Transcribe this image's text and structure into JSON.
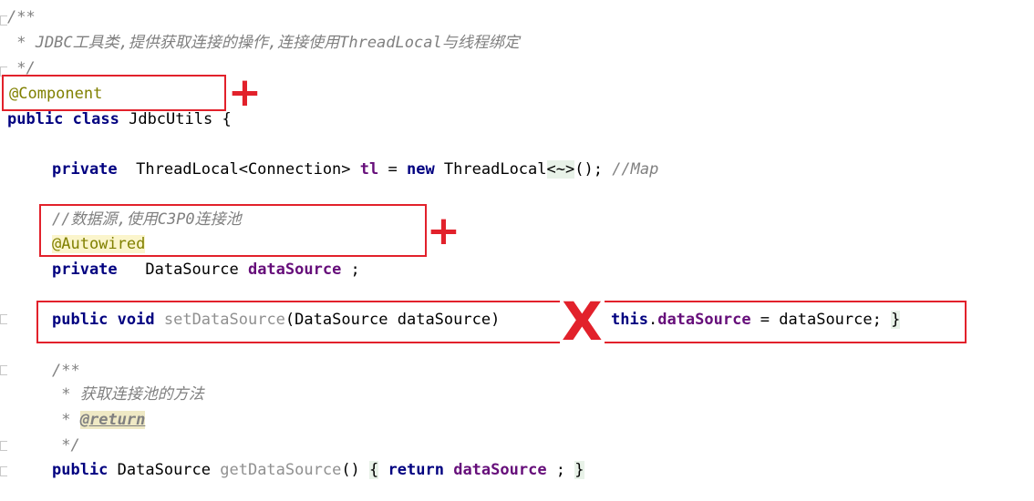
{
  "code": {
    "l1": "/**",
    "l2": " * JDBC工具类,提供获取连接的操作,连接使用ThreadLocal与线程绑定",
    "l3": " */",
    "l4_anno": "@Component",
    "l5_kw1": "public",
    "l5_kw2": "class",
    "l5_name": " JdbcUtils {",
    "l6_kw": "private",
    "l6_type": "  ThreadLocal<Connection> ",
    "l6_field": "tl",
    "l6_eq": " = ",
    "l6_new": "new",
    "l6_type2": " ThreadLocal",
    "l6_diamond": "<~>",
    "l6_end": "(); ",
    "l6_comment": "//Map",
    "l7_comment": "//数据源,使用C3P0连接池",
    "l8_anno": "@Autowired",
    "l9_kw": "private",
    "l9_type": "   DataSource ",
    "l9_field": "dataSource",
    "l9_end": " ;",
    "l10_kw1": "public",
    "l10_kw2": "void",
    "l10_method": " setDataSource",
    "l10_params": "(DataSource dataSource)",
    "l10_this": "this",
    "l10_dot": ".",
    "l10_field": "dataSource",
    "l10_assign": " = dataSource; ",
    "l10_close": "}",
    "l11": "/**",
    "l12": " * 获取连接池的方法",
    "l13_star": " * ",
    "l13_tag": "@return",
    "l14": " */",
    "l15_kw": "public",
    "l15_type": " DataSource ",
    "l15_method": "getDataSource",
    "l15_paren": "() ",
    "l15_open": "{",
    "l15_return": "return",
    "l15_field": "dataSource",
    "l15_end": " ; ",
    "l15_close": "}"
  },
  "marks": {
    "plus1": "+",
    "plus2": "+",
    "cross": "X"
  },
  "colors": {
    "markup_red": "#e2212b",
    "keyword": "#000080",
    "comment": "#808080",
    "annotation": "#808000",
    "field": "#660e7a"
  }
}
